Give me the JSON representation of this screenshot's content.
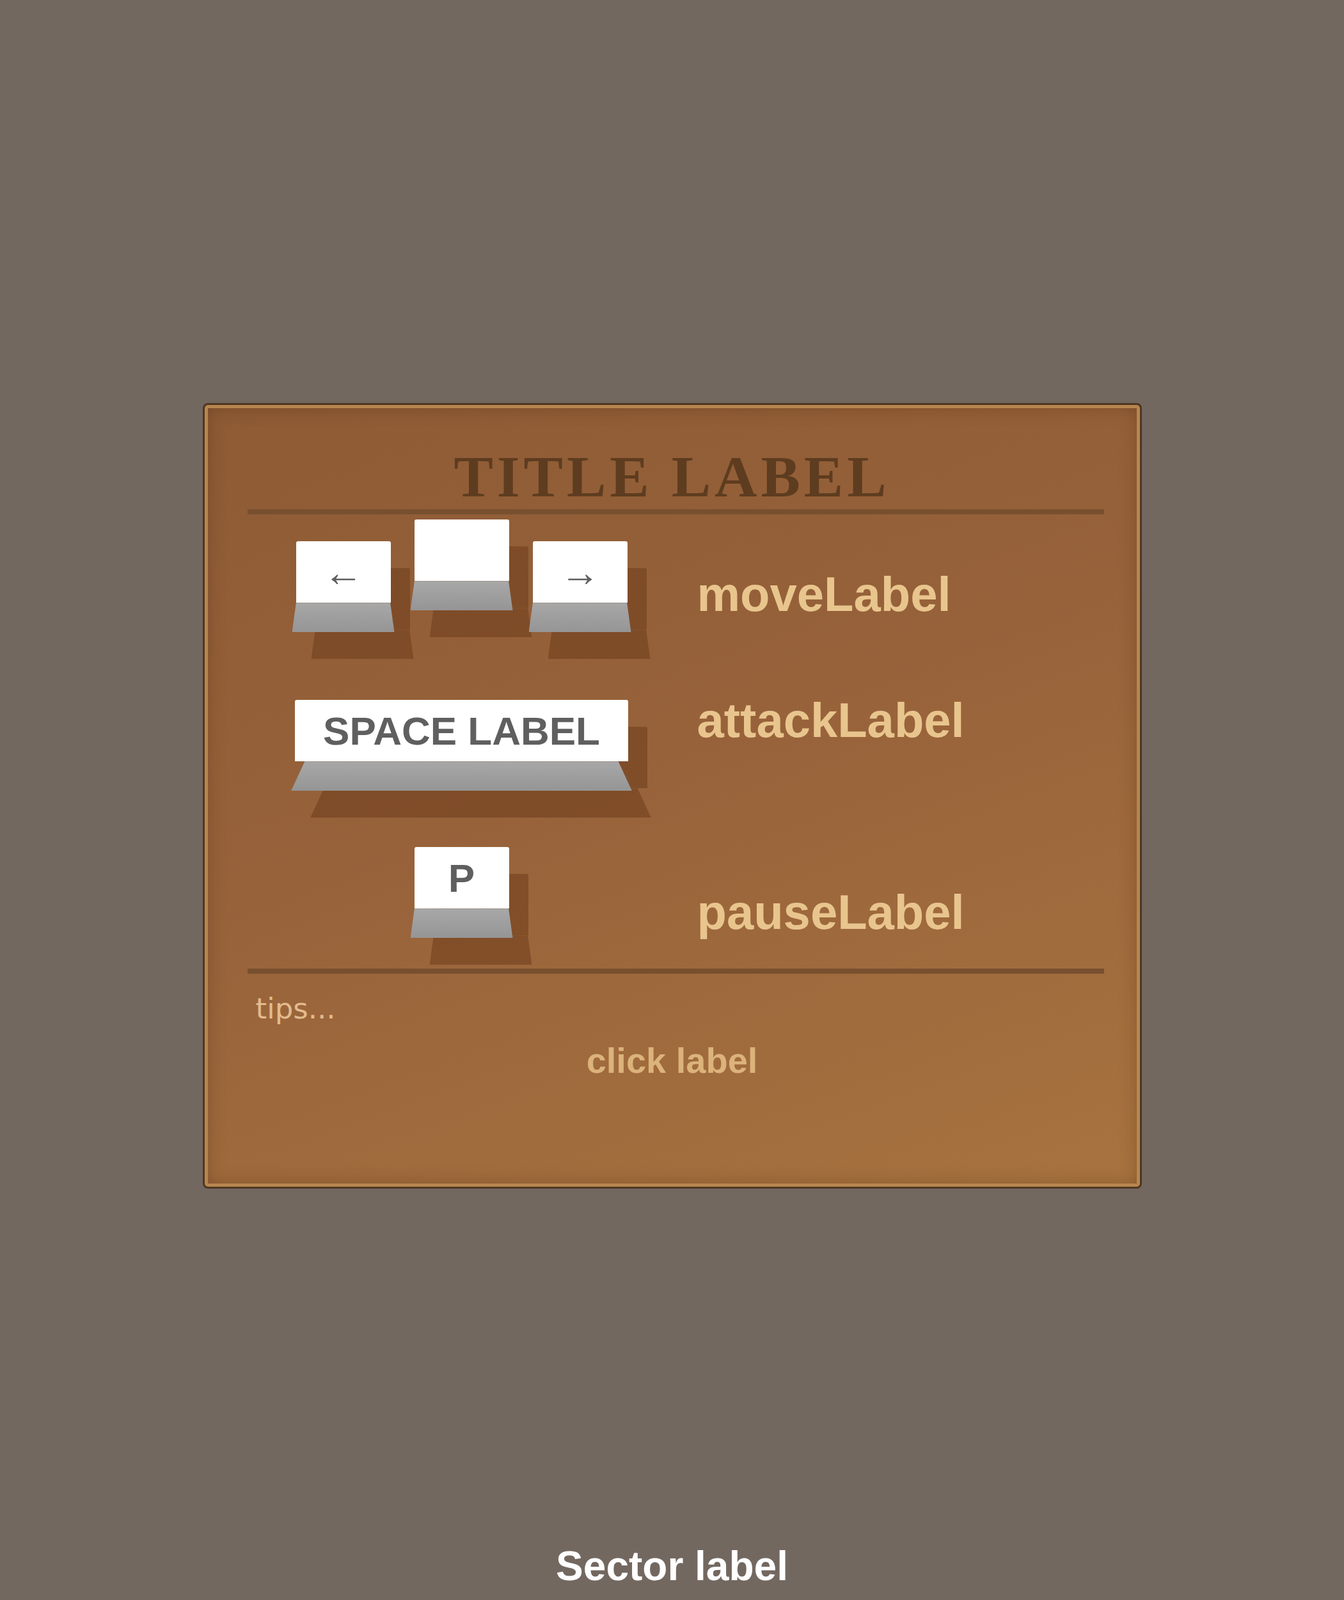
{
  "title": "TITLE LABEL",
  "controls": [
    {
      "keys": [
        "←",
        "",
        "→"
      ],
      "label": "moveLabel"
    },
    {
      "keys": [
        "SPACE LABEL"
      ],
      "label": "attackLabel"
    },
    {
      "keys": [
        "P"
      ],
      "label": "pauseLabel"
    }
  ],
  "tips": "tips...",
  "click_label": "click label",
  "sector_label": "Sector label"
}
